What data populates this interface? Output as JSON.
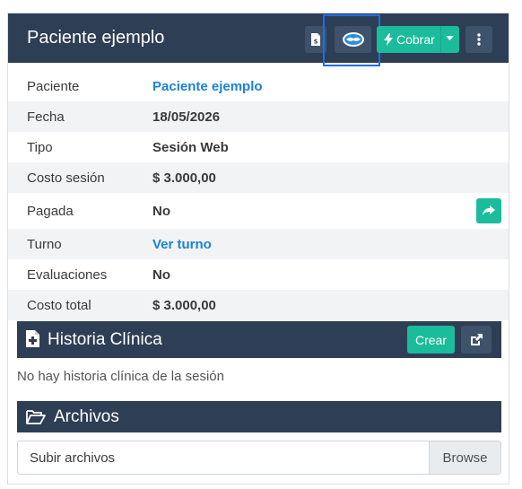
{
  "header": {
    "title": "Paciente ejemplo",
    "cobrar_label": "Cobrar",
    "icons": {
      "invoice": "invoice-dollar-icon",
      "mercadopago": "handshake-icon",
      "cobrar": "bolt-icon",
      "caret": "caret-down-icon",
      "more": "ellipsis-vertical-icon"
    }
  },
  "details": [
    {
      "label": "Paciente",
      "value": "Paciente ejemplo",
      "link": true
    },
    {
      "label": "Fecha",
      "value": "18/05/2026"
    },
    {
      "label": "Tipo",
      "value": "Sesión Web"
    },
    {
      "label": "Costo sesión",
      "value": "$ 3.000,00"
    },
    {
      "label": "Pagada",
      "value": "No"
    },
    {
      "label": "Turno",
      "value": "Ver turno",
      "link": true
    },
    {
      "label": "Evaluaciones",
      "value": "No"
    },
    {
      "label": "Costo total",
      "value": "$ 3.000,00"
    }
  ],
  "historia": {
    "title": "Historia Clínica",
    "crear_label": "Crear",
    "empty_message": "No hay historia clínica de la sesión",
    "icons": {
      "title": "file-medical-icon",
      "open": "external-link-icon"
    }
  },
  "archivos": {
    "title": "Archivos",
    "icon": "folder-open-icon",
    "placeholder": "Subir archivos",
    "browse_label": "Browse"
  },
  "colors": {
    "header_bg": "#2e3e55",
    "accent": "#1bbc9b",
    "link": "#1a82d6",
    "highlight": "#1b6fe6"
  }
}
